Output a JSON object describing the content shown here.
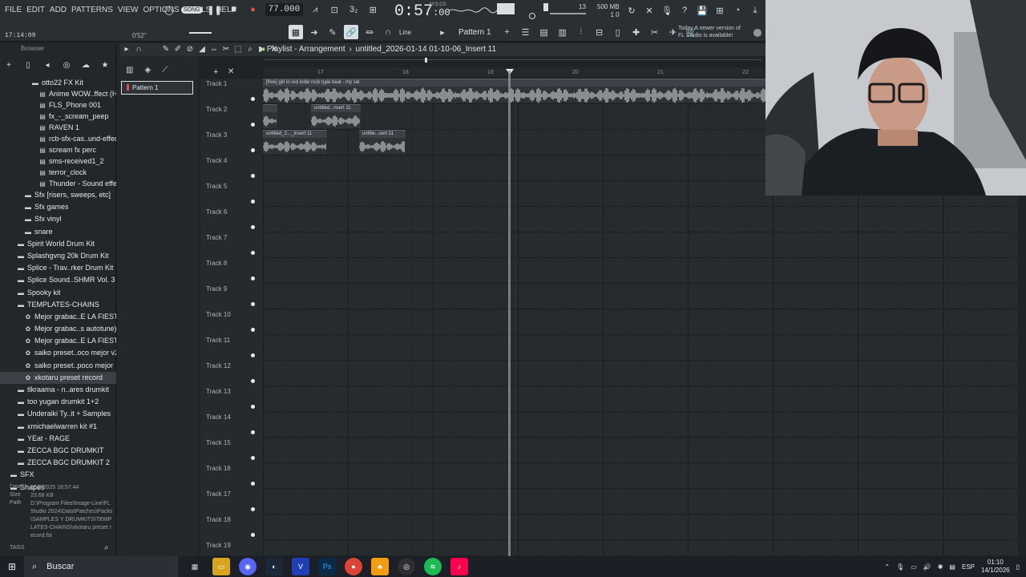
{
  "menu": [
    "FILE",
    "EDIT",
    "ADD",
    "PATTERNS",
    "VIEW",
    "OPTIONS",
    "TOOLS",
    "HELP"
  ],
  "transport": {
    "mode": "SONG",
    "tempo": "77.000",
    "time": "0:57",
    "time_frac": ":00",
    "msc_label": "M:S:CS"
  },
  "cpu": {
    "mem": "500 MB",
    "polyphony": "13",
    "cores": "1",
    "ram_value": "0"
  },
  "hint_time": "17:14:09",
  "hint_tb": "0'52\"",
  "toolbar2": {
    "snap": "Line",
    "pattern": "Pattern 1"
  },
  "update_notice": {
    "line1": "Today  A newer version of",
    "line2": "FL Studio is available!"
  },
  "browser": {
    "label": "Browser",
    "items": [
      {
        "label": "otto22 FX Kit",
        "level": 3,
        "icon": "folder-icon"
      },
      {
        "label": "Anime WOW..ffect (HD)",
        "level": 4,
        "icon": "file-icon"
      },
      {
        "label": "FLS_Phone 001",
        "level": 4,
        "icon": "file-icon"
      },
      {
        "label": "fx_-_scream_peep",
        "level": 4,
        "icon": "file-icon"
      },
      {
        "label": "RAVEN 1",
        "level": 4,
        "icon": "file-icon"
      },
      {
        "label": "rcb-sfx-cas..und-effects",
        "level": 4,
        "icon": "file-icon"
      },
      {
        "label": "scream fx perc",
        "level": 4,
        "icon": "file-icon"
      },
      {
        "label": "sms-received1_2",
        "level": 4,
        "icon": "file-icon"
      },
      {
        "label": "terror_clock",
        "level": 4,
        "icon": "file-icon"
      },
      {
        "label": "Thunder - Sound effect",
        "level": 4,
        "icon": "file-icon"
      },
      {
        "label": "Sfx [risers, sweeps, etc]",
        "level": 2,
        "icon": "folder-icon"
      },
      {
        "label": "Sfx games",
        "level": 2,
        "icon": "folder-icon"
      },
      {
        "label": "Sfx vinyl",
        "level": 2,
        "icon": "folder-icon"
      },
      {
        "label": "snare",
        "level": 2,
        "icon": "folder-icon"
      },
      {
        "label": "Spirit World Drum Kit",
        "level": 1,
        "icon": "folder-icon"
      },
      {
        "label": "Splashgvng 20k Drum Kit",
        "level": 1,
        "icon": "folder-icon"
      },
      {
        "label": "Splice - Trav..rker Drum Kit",
        "level": 1,
        "icon": "folder-icon"
      },
      {
        "label": "Splice Sound..SHMR Vol. 3",
        "level": 1,
        "icon": "folder-icon"
      },
      {
        "label": "Spooky kit",
        "level": 1,
        "icon": "folder-icon"
      },
      {
        "label": "TEMPLATES-CHAINS",
        "level": 1,
        "icon": "folder-open-icon"
      },
      {
        "label": "Mejor grabac..E LA FIESTA",
        "level": 2,
        "icon": "preset-icon"
      },
      {
        "label": "Mejor grabac..s autotune)",
        "level": 2,
        "icon": "preset-icon"
      },
      {
        "label": "Mejor grabac..E LA FIESTA",
        "level": 2,
        "icon": "preset-icon"
      },
      {
        "label": "saiko preset..oco mejor v2",
        "level": 2,
        "icon": "preset-icon"
      },
      {
        "label": "saiko preset..poco mejor",
        "level": 2,
        "icon": "preset-icon"
      },
      {
        "label": "xkotaru preset record",
        "level": 2,
        "icon": "preset-icon",
        "selected": true
      },
      {
        "label": "tlkraama - n..ares drumkit",
        "level": 1,
        "icon": "folder-icon"
      },
      {
        "label": "too yugan drumkit 1+2",
        "level": 1,
        "icon": "folder-icon"
      },
      {
        "label": "Underaiki Ty..it + Samples",
        "level": 1,
        "icon": "folder-icon"
      },
      {
        "label": "xmichaelwarren kit #1",
        "level": 1,
        "icon": "folder-icon"
      },
      {
        "label": "YEat - RAGE",
        "level": 1,
        "icon": "folder-icon"
      },
      {
        "label": "ZECCA BGC DRUMKIT",
        "level": 1,
        "icon": "folder-icon"
      },
      {
        "label": "ZECCA BGC DRUMKIT 2",
        "level": 1,
        "icon": "folder-icon"
      },
      {
        "label": "SFX",
        "level": 0,
        "icon": "folder-icon"
      },
      {
        "label": "Shapes",
        "level": 0,
        "icon": "folder-icon"
      }
    ],
    "info": {
      "date_label": "Date",
      "date": "26/2/2025 18:57:44",
      "size_label": "Size",
      "size": "23.68 KB",
      "path_label": "Path",
      "path": "D:\\Program Files\\Image-Line\\FL Studio 2024\\Data\\Patches\\Packs\\SAMPLES Y DRUMKITS\\TEMPLATES-CHAINS\\xkotaru preset record.fst"
    },
    "tags": "TAGS"
  },
  "picker": {
    "pattern": "Pattern 1"
  },
  "playlist": {
    "title": "Playlist - Arrangement",
    "subtitle": "untitled_2026-01-14 01-10-06_Insert 11",
    "ruler": [
      "17",
      "18",
      "19",
      "20",
      "21",
      "22"
    ],
    "tracks": [
      "Track 1",
      "Track 2",
      "Track 3",
      "Track 4",
      "Track 5",
      "Track 6",
      "Track 7",
      "Track 8",
      "Track 9",
      "Track 10",
      "Track 11",
      "Track 12",
      "Track 13",
      "Track 14",
      "Track 15",
      "Track 16",
      "Track 17",
      "Track 18",
      "Track 19"
    ],
    "clips": [
      {
        "track": 1,
        "label": "[free] girl in red  indie rock type beat - my sel"
      },
      {
        "track": 2,
        "label": ""
      },
      {
        "track": 2,
        "label": "untitled...nsert 11"
      },
      {
        "track": 3,
        "label": "untitled_2..._Insert 11"
      },
      {
        "track": 3,
        "label": "untitle...sert 11"
      }
    ]
  },
  "taskbar": {
    "search": "Buscar",
    "apps": [
      "app-1-icon",
      "files-icon",
      "discord-icon",
      "steam-icon",
      "vegas-icon",
      "photoshop-icon",
      "chrome-icon",
      "fl-studio-icon",
      "obs-icon",
      "spotify-icon",
      "tiktok-icon"
    ],
    "lang": "ESP",
    "time": "01:10",
    "date": "14/1/2026"
  }
}
